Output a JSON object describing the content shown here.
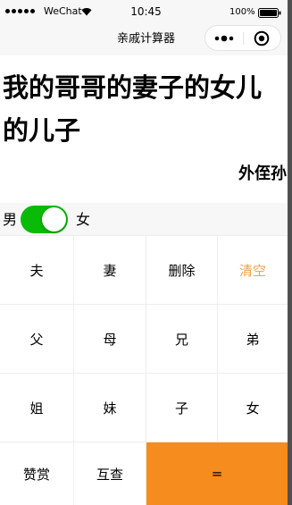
{
  "status_bar": {
    "carrier": "WeChat",
    "time": "10:45",
    "battery": "100%",
    "signal_icon": "signal-dots-icon",
    "wifi_icon": "wifi-icon",
    "battery_icon": "battery-full-icon"
  },
  "nav": {
    "title": "亲戚计算器",
    "more_icon": "more-dots-icon",
    "close_icon": "target-close-icon"
  },
  "display": {
    "expression": "我的哥哥的妻子的女儿的儿子",
    "result": "外侄孙"
  },
  "gender": {
    "male_label": "男",
    "female_label": "女",
    "toggle_state": "on"
  },
  "keypad": {
    "rows": [
      [
        {
          "label": "夫"
        },
        {
          "label": "妻"
        },
        {
          "label": "删除"
        },
        {
          "label": "清空"
        }
      ],
      [
        {
          "label": "父"
        },
        {
          "label": "母"
        },
        {
          "label": "兄"
        },
        {
          "label": "弟"
        }
      ],
      [
        {
          "label": "姐"
        },
        {
          "label": "妹"
        },
        {
          "label": "子"
        },
        {
          "label": "女"
        }
      ],
      [
        {
          "label": "赞赏"
        },
        {
          "label": "互查"
        },
        {
          "label": "="
        }
      ]
    ]
  },
  "colors": {
    "switch_on": "#09bb07",
    "accent_text": "#f0a24a",
    "equals_button": "#f68b1e"
  }
}
